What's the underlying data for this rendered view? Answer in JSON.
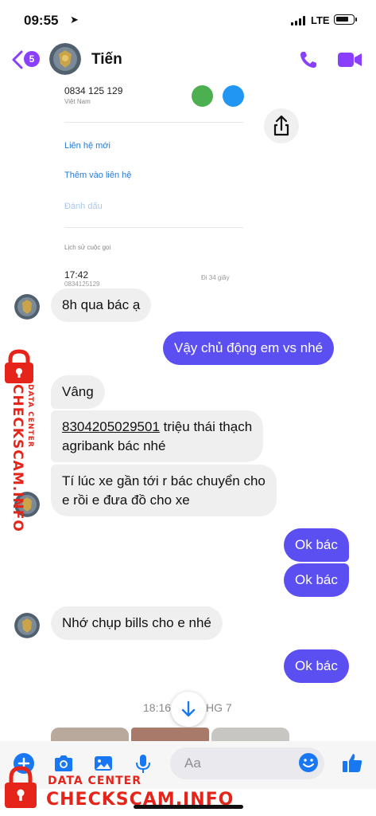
{
  "status_bar": {
    "time": "09:55",
    "network": "LTE"
  },
  "header": {
    "back_count": "5",
    "contact_name": "Tiến"
  },
  "shared_image": {
    "phone_number": "0834 125 129",
    "country": "Việt Nam",
    "actions": [
      "Liên hệ mới",
      "Thêm vào liên hệ",
      "Đánh dấu"
    ],
    "history_label": "Lịch sử cuộc gọi",
    "call_time": "17:42",
    "call_number": "0834125129",
    "call_duration": "Đi 34 giây"
  },
  "messages": [
    {
      "id": "m1",
      "direction": "in",
      "text": "8h qua bác ạ"
    },
    {
      "id": "m2",
      "direction": "out",
      "text": "Vậy chủ động em vs nhé"
    },
    {
      "id": "m3",
      "direction": "in",
      "text": "Vâng"
    },
    {
      "id": "m4",
      "direction": "in",
      "account": "8304205029501",
      "text_line1_rest": " triệu thái thạch",
      "text_line2": "agribank bác nhé"
    },
    {
      "id": "m5",
      "direction": "in",
      "text_line1": "Tí lúc xe gần tới r bác chuyển cho",
      "text_line2": "e rồi e đưa đồ cho xe"
    },
    {
      "id": "m6",
      "direction": "out",
      "text": "Ok bác"
    },
    {
      "id": "m7",
      "direction": "out",
      "text": "Ok bác"
    },
    {
      "id": "m8",
      "direction": "in",
      "text": "Nhớ chụp bills cho e nhé"
    },
    {
      "id": "m9",
      "direction": "out",
      "text": "Ok bác"
    }
  ],
  "timestamp": {
    "time": "18:16",
    "day_suffix": "HG 7"
  },
  "composer": {
    "placeholder": "Aa"
  },
  "watermark": {
    "title": "CHECKSCAM.INFO",
    "subtitle": "DATA CENTER"
  },
  "colors": {
    "accent": "#8a3ffc",
    "outgoing_bubble": "#5b4ff2",
    "incoming_bubble": "#efefef",
    "messenger_blue": "#1877f2",
    "watermark_red": "#e5241a"
  },
  "icons": [
    "location-arrow-icon",
    "signal-icon",
    "battery-icon",
    "back-chevron-icon",
    "phone-icon",
    "video-camera-icon",
    "share-icon",
    "chevron-down-icon",
    "plus-icon",
    "camera-icon",
    "gallery-icon",
    "microphone-icon",
    "emoji-icon",
    "thumbs-up-icon",
    "lock-icon"
  ]
}
